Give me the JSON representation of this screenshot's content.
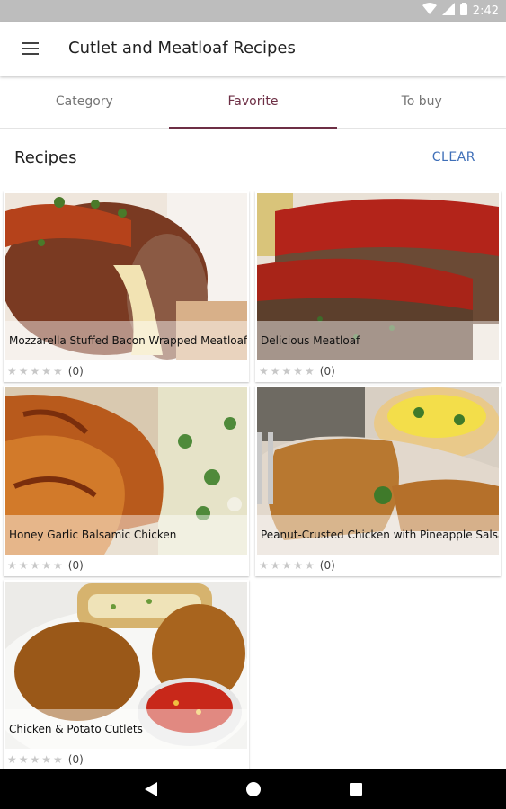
{
  "status_bar": {
    "time": "2:42",
    "icons": [
      "wifi-icon",
      "signal-icon",
      "battery-icon"
    ]
  },
  "app_bar": {
    "menu_icon": "hamburger-menu-icon",
    "title": "Cutlet and Meatloaf Recipes"
  },
  "tabs": [
    {
      "label": "Category",
      "active": false
    },
    {
      "label": "Favorite",
      "active": true
    },
    {
      "label": "To buy",
      "active": false
    }
  ],
  "section": {
    "title": "Recipes",
    "clear_label": "CLEAR"
  },
  "recipes": [
    {
      "title": "Mozzarella Stuffed Bacon Wrapped Meatloaf",
      "stars": "★★★★★",
      "count": "(0)"
    },
    {
      "title": "Delicious Meatloaf",
      "stars": "★★★★★",
      "count": "(0)"
    },
    {
      "title": "Honey Garlic Balsamic Chicken",
      "stars": "★★★★★",
      "count": "(0)"
    },
    {
      "title": "Peanut-Crusted Chicken with Pineapple Salsa",
      "stars": "★★★★★",
      "count": "(0)"
    },
    {
      "title": "Chicken & Potato Cutlets",
      "stars": "★★★★★",
      "count": "(0)"
    }
  ],
  "rating_value": 0,
  "colors": {
    "accent": "#6d2f45",
    "link": "#3f6fb8",
    "status_bar": "#bdbdbd",
    "nav_bar": "#000000"
  },
  "nav_bar": {
    "icons": [
      "back-icon",
      "home-icon",
      "recents-icon"
    ]
  }
}
